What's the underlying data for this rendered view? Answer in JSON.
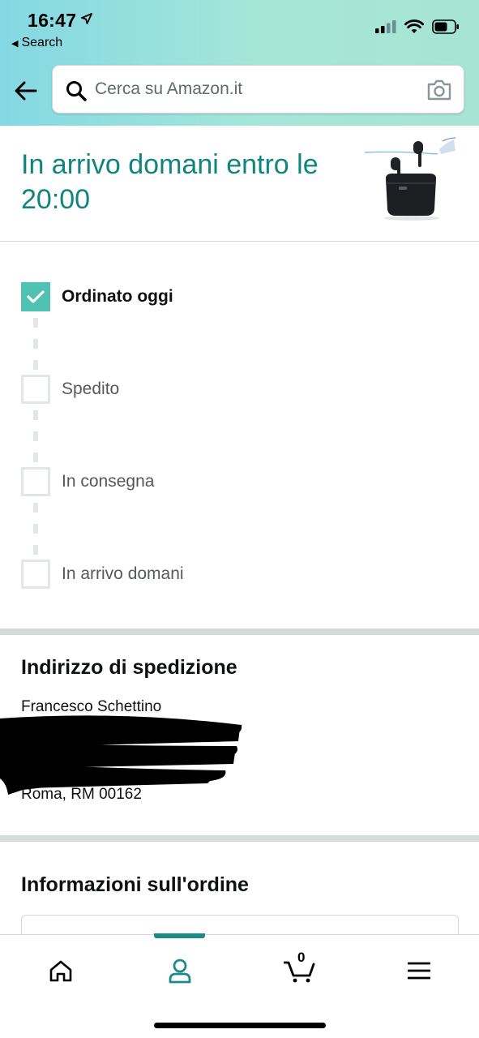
{
  "status_bar": {
    "time": "16:47",
    "back_label": "Search"
  },
  "search": {
    "placeholder": "Cerca su Amazon.it"
  },
  "arrival": {
    "title": "In arrivo domani entro le 20:00"
  },
  "tracking": {
    "steps": [
      {
        "label": "Ordinato oggi",
        "done": true
      },
      {
        "label": "Spedito",
        "done": false
      },
      {
        "label": "In consegna",
        "done": false
      },
      {
        "label": "In arrivo domani",
        "done": false
      }
    ]
  },
  "address": {
    "heading": "Indirizzo di spedizione",
    "name": "Francesco Schettino",
    "city_line": "Roma, RM 00162"
  },
  "order_info": {
    "heading": "Informazioni sull'ordine"
  },
  "bottom_nav": {
    "cart_count": "0",
    "active_tab": "account"
  },
  "colors": {
    "accent": "#10847e",
    "check": "#4fc2b2",
    "nav_active": "#1c8a86"
  }
}
